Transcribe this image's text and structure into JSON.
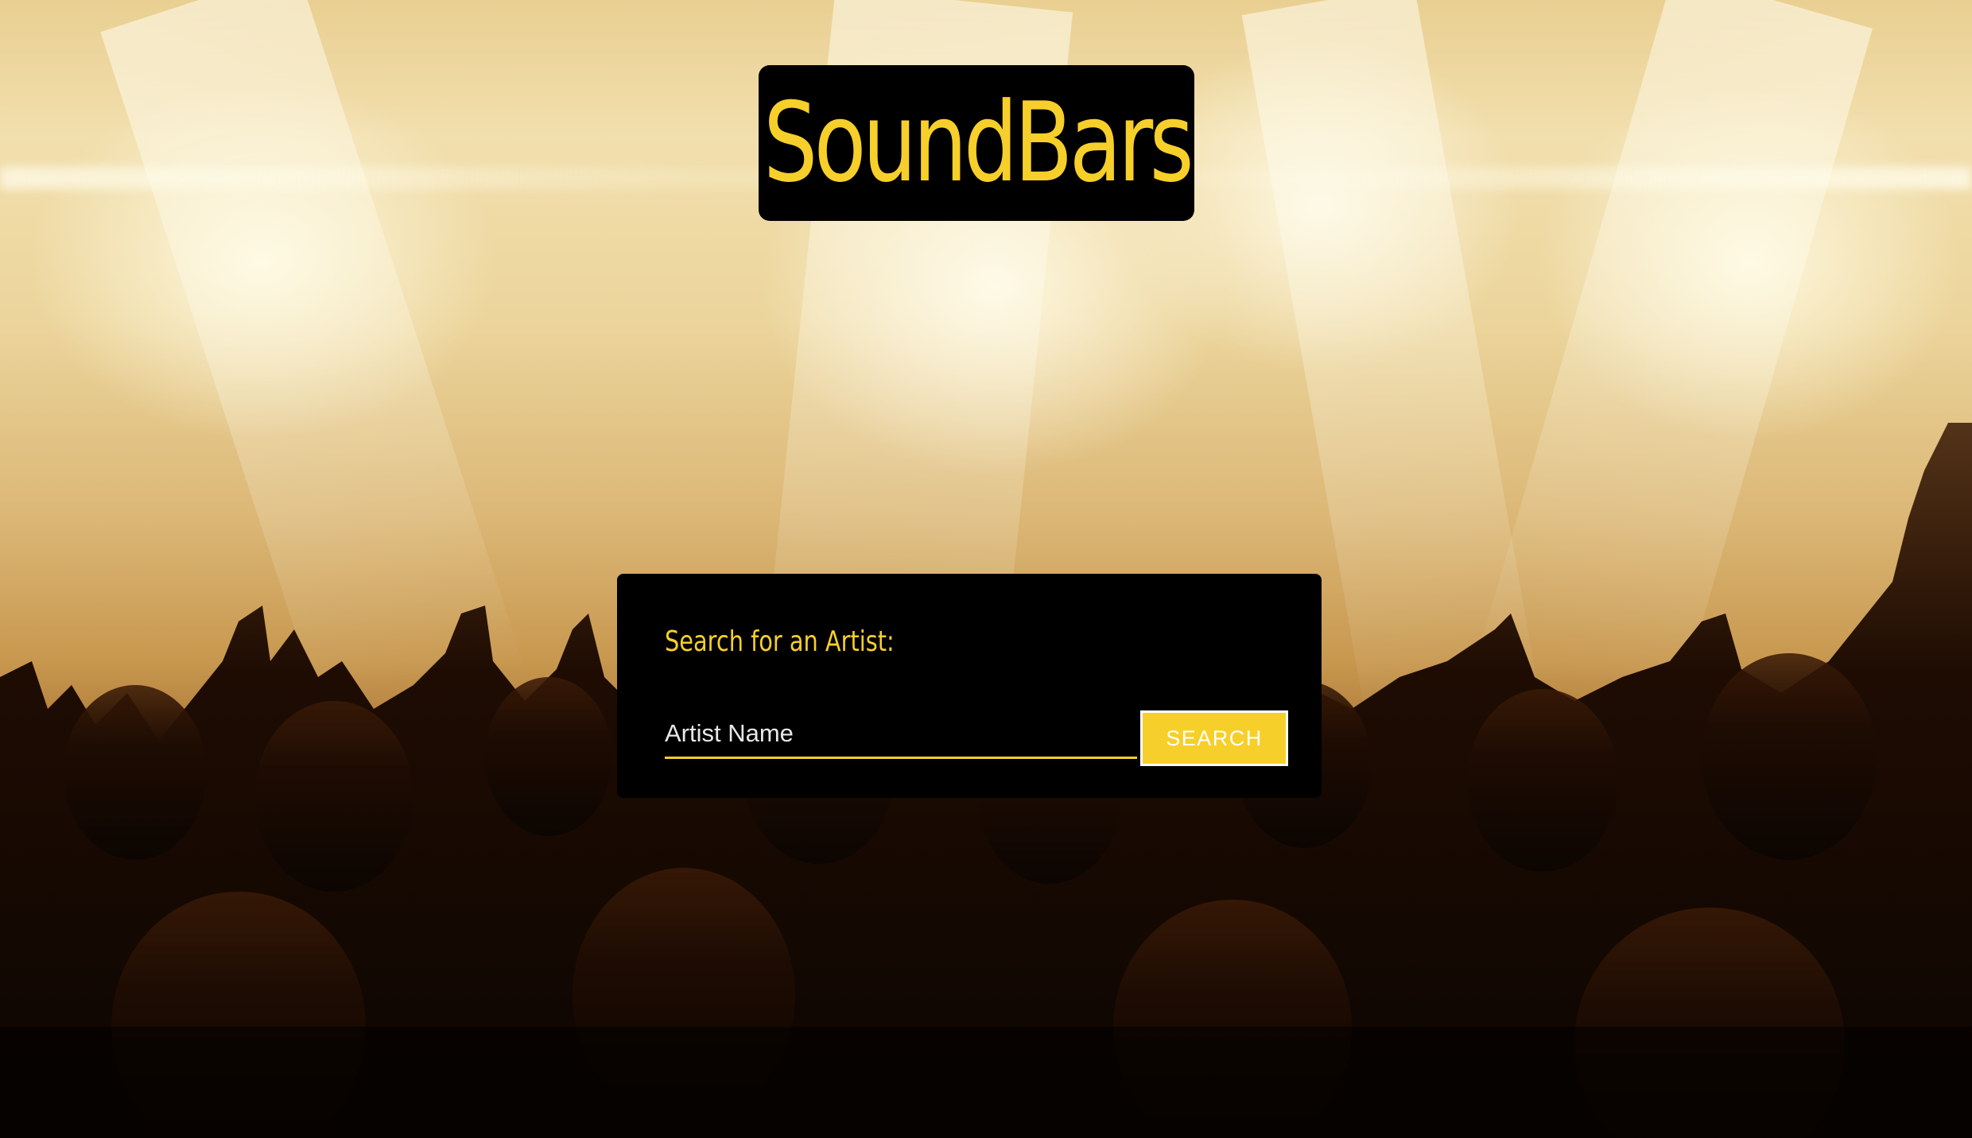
{
  "header": {
    "title": "SoundBars"
  },
  "search": {
    "label": "Search for an Artist:",
    "placeholder": "Artist Name",
    "value": "",
    "button_label": "SEARCH"
  },
  "colors": {
    "accent": "#f7cf2a",
    "panel_background": "#000000",
    "input_text": "#e8e8e8"
  }
}
